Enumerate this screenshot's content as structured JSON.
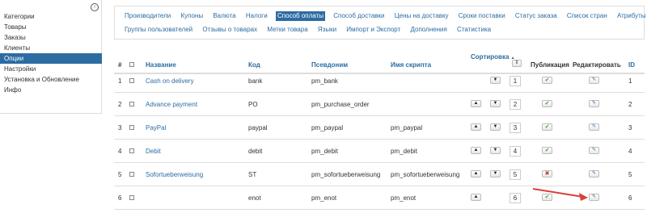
{
  "sidebar": {
    "collapse_icon": "chevron-left-circle-icon",
    "items": [
      {
        "label": "Категории"
      },
      {
        "label": "Товары"
      },
      {
        "label": "Заказы"
      },
      {
        "label": "Клиенты"
      },
      {
        "label": "Опции",
        "active": true
      },
      {
        "label": "Настройки"
      },
      {
        "label": "Установка и Обновление"
      },
      {
        "label": "Инфо"
      }
    ]
  },
  "tabs": {
    "row1": [
      "Производители",
      "Купоны",
      "Валюта",
      "Налоги",
      "Способ оплаты",
      "Способ доставки",
      "Цены на доставку",
      "Сроки поставки",
      "Статус заказа",
      "Список стран",
      "Атрибуты"
    ],
    "row2": [
      "Группы пользователей",
      "Отзывы о товарах",
      "Метки товара",
      "Языки",
      "Импорт и Экспорт",
      "Дополнения",
      "Статистика"
    ],
    "active": "Способ оплаты"
  },
  "table": {
    "headers": {
      "num": "#",
      "name": "Название",
      "code": "Код",
      "alias": "Псевдоним",
      "script": "Имя скрипта",
      "sort": "Сортировка",
      "sort_indicator": "▲",
      "publish": "Публикация",
      "edit": "Редактировать",
      "id": "ID"
    },
    "rows": [
      {
        "num": "1",
        "name": "Cash on delivery",
        "code": "bank",
        "alias": "pm_bank",
        "script": "",
        "order": "1",
        "up": false,
        "down": true,
        "published": true,
        "id": "1"
      },
      {
        "num": "2",
        "name": "Advance payment",
        "code": "PO",
        "alias": "pm_purchase_order",
        "script": "",
        "order": "2",
        "up": true,
        "down": true,
        "published": true,
        "id": "2"
      },
      {
        "num": "3",
        "name": "PayPal",
        "code": "paypal",
        "alias": "pm_paypal",
        "script": "pm_paypal",
        "order": "3",
        "up": true,
        "down": true,
        "published": true,
        "id": "3"
      },
      {
        "num": "4",
        "name": "Debit",
        "code": "debit",
        "alias": "pm_debit",
        "script": "pm_debit",
        "order": "4",
        "up": true,
        "down": true,
        "published": true,
        "id": "4"
      },
      {
        "num": "5",
        "name": "Sofortueberweisung",
        "code": "ST",
        "alias": "pm_sofortueberweisung",
        "script": "pm_sofortueberweisung",
        "order": "5",
        "up": true,
        "down": true,
        "published": false,
        "id": "5"
      },
      {
        "num": "6",
        "name": "",
        "code": "enot",
        "alias": "pm_enot",
        "script": "pm_enot",
        "order": "6",
        "up": true,
        "down": false,
        "published": true,
        "id": "6"
      }
    ]
  },
  "annotation": {
    "color": "#d9413a",
    "icon": "red-arrow-icon"
  }
}
